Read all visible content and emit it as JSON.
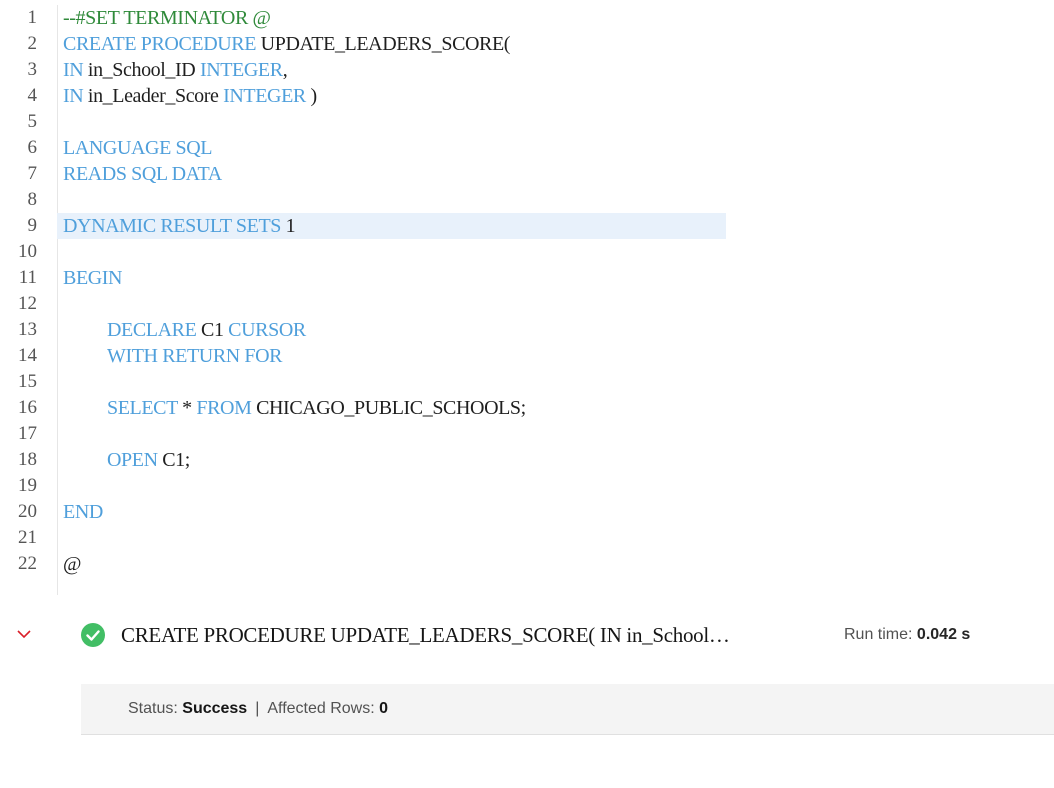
{
  "editor": {
    "lines": [
      {
        "n": "1",
        "indent": false,
        "tokens": [
          {
            "t": "--#SET TERMINATOR @",
            "c": "cm"
          }
        ]
      },
      {
        "n": "2",
        "indent": false,
        "tokens": [
          {
            "t": "CREATE PROCEDURE ",
            "c": "kw"
          },
          {
            "t": "UPDATE_LEADERS_SCORE(",
            "c": "tx"
          }
        ]
      },
      {
        "n": "3",
        "indent": false,
        "tokens": [
          {
            "t": "IN ",
            "c": "kw"
          },
          {
            "t": "in_School_ID ",
            "c": "tx"
          },
          {
            "t": "INTEGER",
            "c": "kw"
          },
          {
            "t": ",",
            "c": "tx"
          }
        ]
      },
      {
        "n": "4",
        "indent": false,
        "tokens": [
          {
            "t": "IN ",
            "c": "kw"
          },
          {
            "t": "in_Leader_Score ",
            "c": "tx"
          },
          {
            "t": "INTEGER ",
            "c": "kw"
          },
          {
            "t": ")",
            "c": "tx"
          }
        ]
      },
      {
        "n": "5",
        "indent": false,
        "tokens": []
      },
      {
        "n": "6",
        "indent": false,
        "tokens": [
          {
            "t": "LANGUAGE SQL",
            "c": "kw"
          }
        ]
      },
      {
        "n": "7",
        "indent": false,
        "tokens": [
          {
            "t": "READS SQL DATA",
            "c": "kw"
          }
        ]
      },
      {
        "n": "8",
        "indent": false,
        "tokens": []
      },
      {
        "n": "9",
        "indent": false,
        "highlighted": true,
        "tokens": [
          {
            "t": "DYNAMIC RESULT SETS ",
            "c": "kw"
          },
          {
            "t": "1",
            "c": "tx"
          }
        ]
      },
      {
        "n": "10",
        "indent": false,
        "tokens": []
      },
      {
        "n": "11",
        "indent": false,
        "tokens": [
          {
            "t": "BEGIN",
            "c": "kw"
          }
        ]
      },
      {
        "n": "12",
        "indent": false,
        "tokens": []
      },
      {
        "n": "13",
        "indent": true,
        "tokens": [
          {
            "t": "DECLARE ",
            "c": "kw"
          },
          {
            "t": "C1 ",
            "c": "tx"
          },
          {
            "t": "CURSOR",
            "c": "kw"
          }
        ]
      },
      {
        "n": "14",
        "indent": true,
        "tokens": [
          {
            "t": "WITH RETURN FOR",
            "c": "kw"
          }
        ]
      },
      {
        "n": "15",
        "indent": false,
        "tokens": []
      },
      {
        "n": "16",
        "indent": true,
        "tokens": [
          {
            "t": "SELECT ",
            "c": "kw"
          },
          {
            "t": "* ",
            "c": "tx"
          },
          {
            "t": "FROM ",
            "c": "kw"
          },
          {
            "t": "CHICAGO_PUBLIC_SCHOOLS;",
            "c": "tx"
          }
        ]
      },
      {
        "n": "17",
        "indent": false,
        "tokens": []
      },
      {
        "n": "18",
        "indent": true,
        "tokens": [
          {
            "t": "OPEN ",
            "c": "kw"
          },
          {
            "t": "C1;",
            "c": "tx"
          }
        ]
      },
      {
        "n": "19",
        "indent": false,
        "tokens": []
      },
      {
        "n": "20",
        "indent": false,
        "tokens": [
          {
            "t": "END",
            "c": "kw"
          }
        ]
      },
      {
        "n": "21",
        "indent": false,
        "tokens": []
      },
      {
        "n": "22",
        "indent": false,
        "tokens": [
          {
            "t": "@",
            "c": "tx"
          }
        ]
      }
    ]
  },
  "result": {
    "title": "CREATE PROCEDURE UPDATE_LEADERS_SCORE( IN in_School…",
    "run_time_label": "Run time:",
    "run_time_value": "0.042 s",
    "status_label": "Status:",
    "status_value": "Success",
    "separator": "|",
    "affected_label": "Affected Rows:",
    "affected_value": "0",
    "status_color": "#42be65"
  },
  "icons": {
    "collapse": "chevron-down-icon",
    "success": "checkmark-filled-icon"
  },
  "colors": {
    "keyword": "#4f9fdb",
    "comment": "#2f8a3a",
    "text": "#1f1f1f",
    "line_highlight": "#e8f1fb",
    "chevron": "#da1e28"
  }
}
